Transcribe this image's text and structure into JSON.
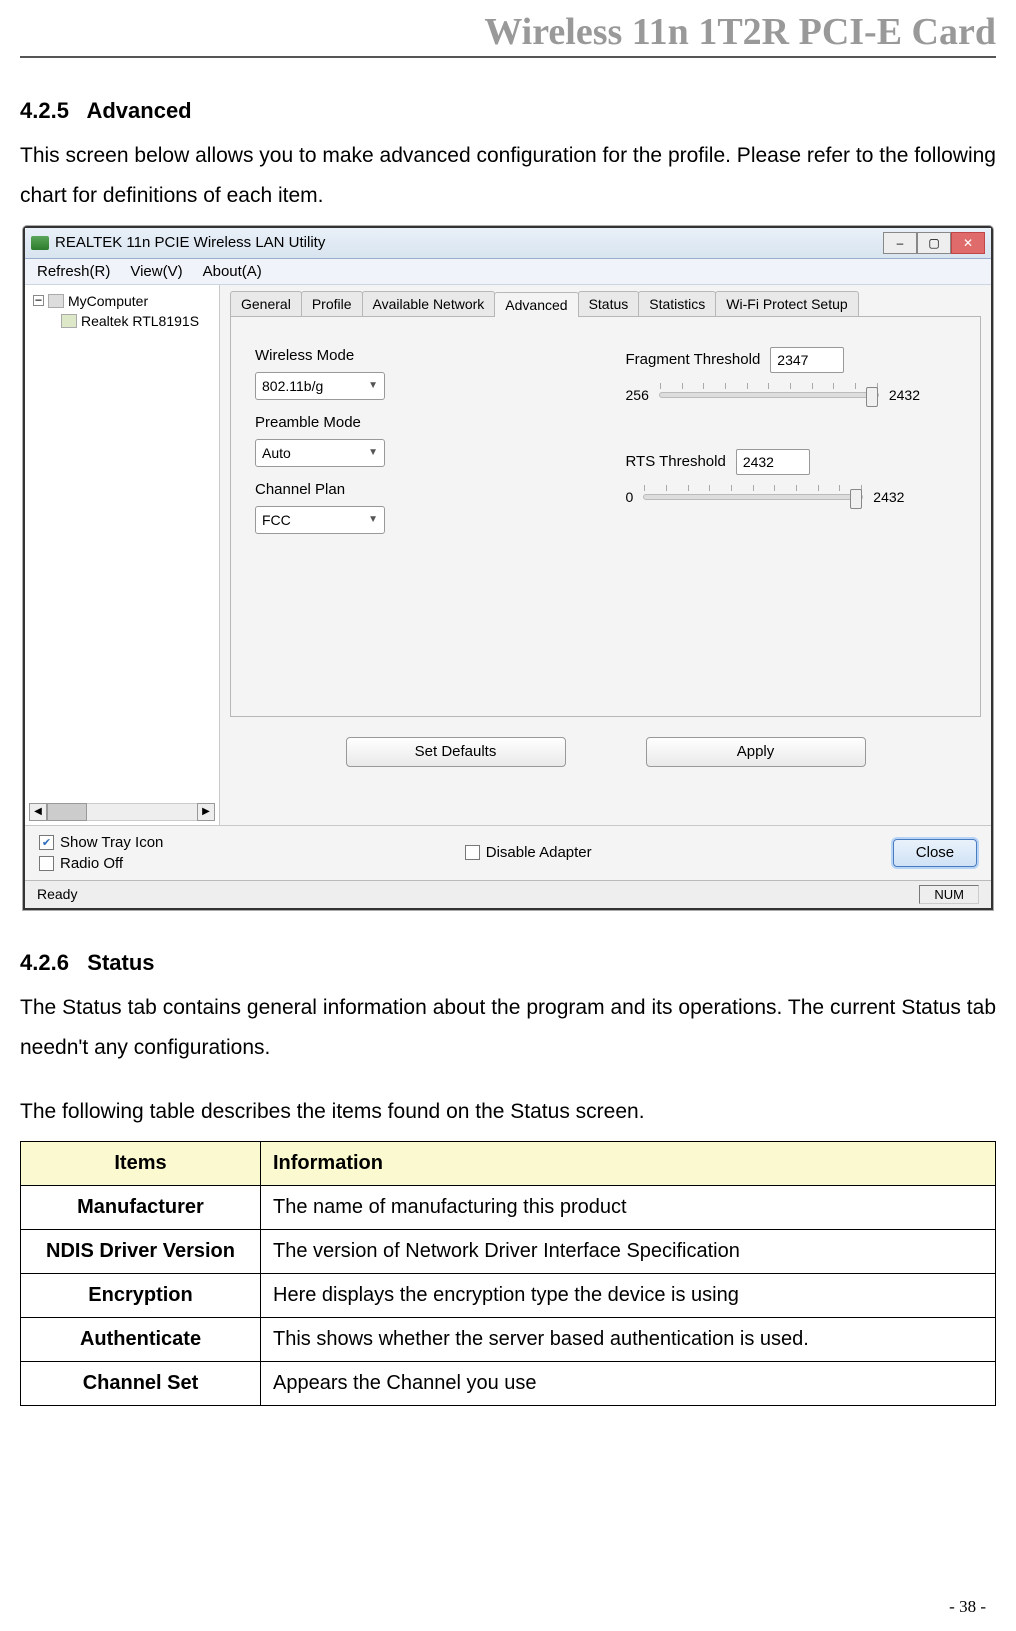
{
  "header": {
    "title": "Wireless 11n 1T2R PCI-E Card"
  },
  "sec1": {
    "num": "4.2.5",
    "name": "Advanced",
    "para": "This screen below allows you to make advanced configuration for the profile. Please refer to the following chart for definitions of each item."
  },
  "window": {
    "title": "REALTEK 11n PCIE Wireless LAN Utility",
    "menu": {
      "refresh": "Refresh(R)",
      "view": "View(V)",
      "about": "About(A)"
    },
    "tree": {
      "root": "MyComputer",
      "child": "Realtek RTL8191S"
    },
    "tabs": [
      "General",
      "Profile",
      "Available Network",
      "Advanced",
      "Status",
      "Statistics",
      "Wi-Fi Protect Setup"
    ],
    "wireless_mode_label": "Wireless Mode",
    "wireless_mode_value": "802.11b/g",
    "preamble_label": "Preamble Mode",
    "preamble_value": "Auto",
    "channel_plan_label": "Channel Plan",
    "channel_plan_value": "FCC",
    "frag_label": "Fragment Threshold",
    "frag_value": "2347",
    "frag_min": "256",
    "frag_max": "2432",
    "rts_label": "RTS Threshold",
    "rts_value": "2432",
    "rts_min": "0",
    "rts_max": "2432",
    "set_defaults": "Set Defaults",
    "apply": "Apply",
    "show_tray": "Show Tray Icon",
    "radio_off": "Radio Off",
    "disable_adapter": "Disable Adapter",
    "close": "Close",
    "ready": "Ready",
    "num": "NUM"
  },
  "sec2": {
    "num": "4.2.6",
    "name": "Status",
    "para1": "The Status tab contains general information about the program and its operations. The current Status tab needn't any configurations.",
    "para2": "The following table describes the items found on the Status screen."
  },
  "table": {
    "headers": {
      "items": "Items",
      "info": "Information"
    },
    "rows": [
      {
        "item": "Manufacturer",
        "info": "The name of manufacturing this product"
      },
      {
        "item": "NDIS Driver Version",
        "info": "The version of Network Driver Interface Specification"
      },
      {
        "item": "Encryption",
        "info": "Here displays the encryption type the device is using"
      },
      {
        "item": "Authenticate",
        "info": "This shows whether the server based authentication is used."
      },
      {
        "item": "Channel Set",
        "info": "Appears the Channel you use"
      }
    ]
  },
  "page_number": "- 38 -"
}
